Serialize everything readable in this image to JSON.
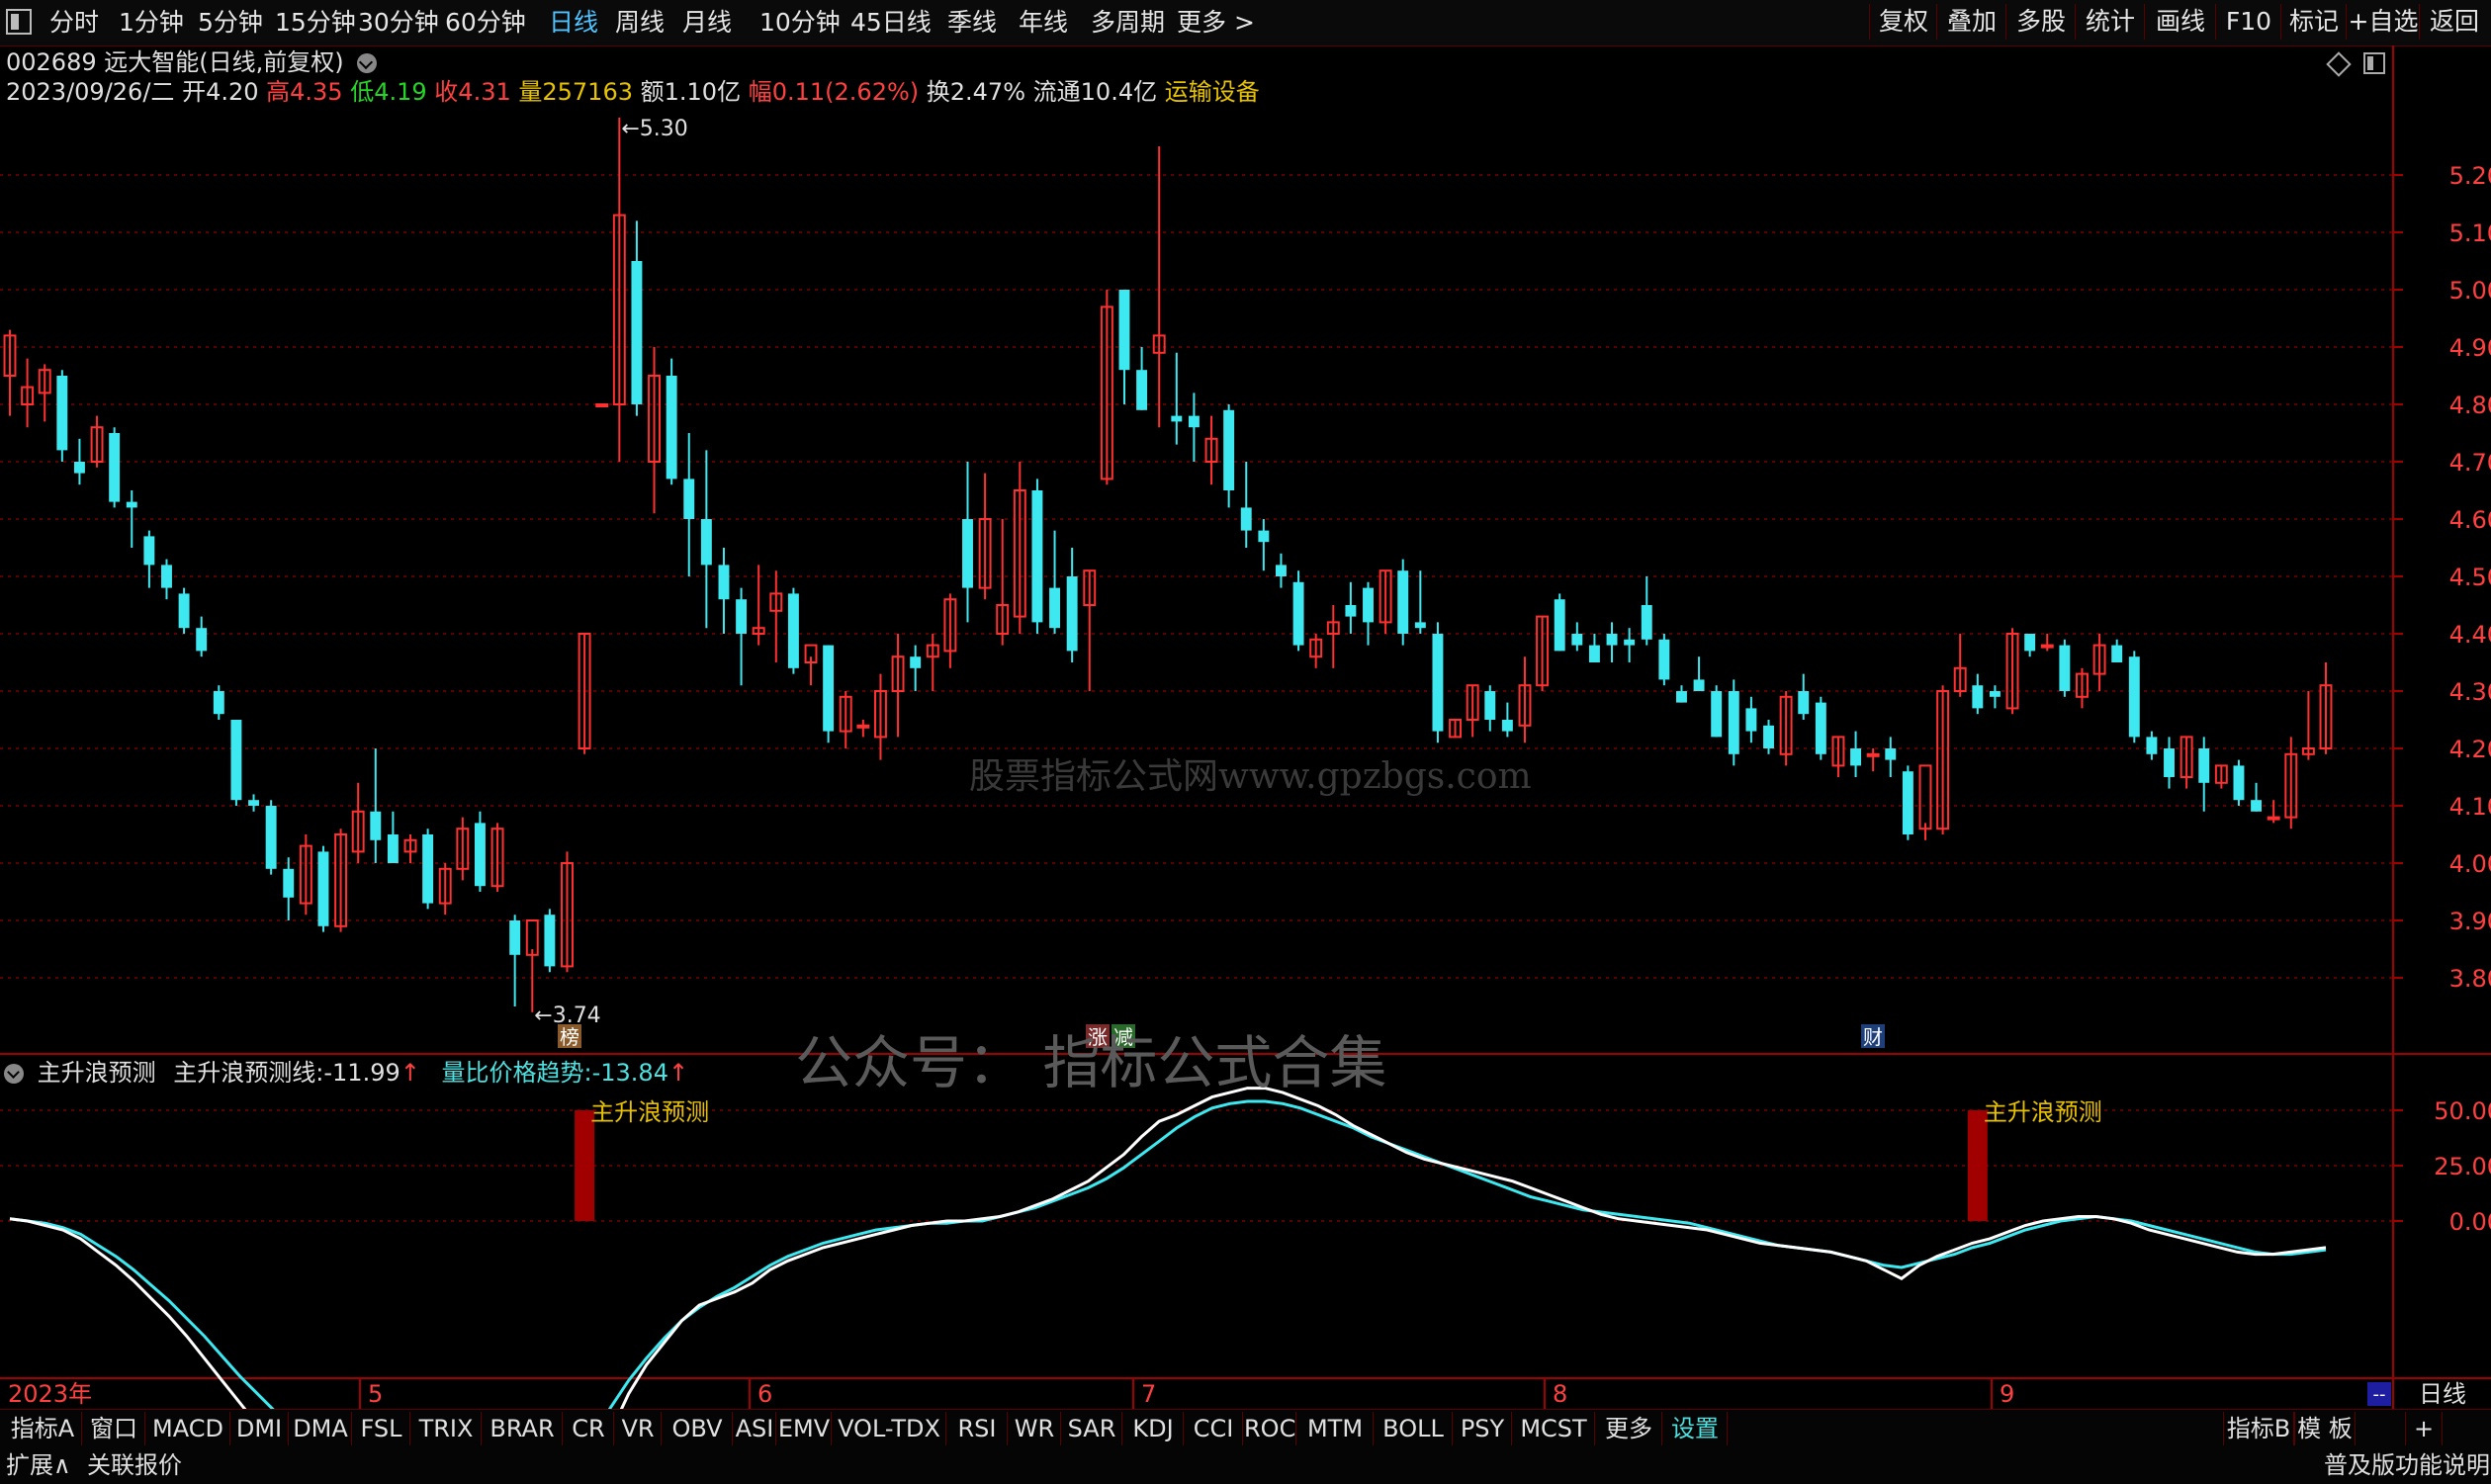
{
  "topbar": {
    "menu_icon": "menu-square-icon",
    "periods": [
      "分时",
      "1分钟",
      "5分钟",
      "15分钟",
      "30分钟",
      "60分钟",
      "日线",
      "周线",
      "月线",
      "10分钟",
      "45日线",
      "季线",
      "年线",
      "多周期",
      "更多 >"
    ],
    "active_period": "日线",
    "right_buttons": [
      "复权",
      "叠加",
      "多股",
      "统计",
      "画线",
      "F10",
      "标记",
      "+自选",
      "返回"
    ]
  },
  "stock": {
    "code_name": "002689 远大智能(日线,前复权)",
    "date": "2023/09/26/二",
    "open_label": "开",
    "open": "4.20",
    "high_label": "高",
    "high": "4.35",
    "low_label": "低",
    "low": "4.19",
    "close_label": "收",
    "close": "4.31",
    "volume_label": "量",
    "volume": "257163",
    "amount_label": "额",
    "amount": "1.10亿",
    "change_label": "幅",
    "change": "0.11(2.62%)",
    "turnover_label": "换",
    "turnover": "2.47%",
    "float_label": "流通",
    "float": "10.4亿",
    "sector": "运输设备"
  },
  "price_axis": [
    "5.20",
    "5.10",
    "5.00",
    "4.90",
    "4.80",
    "4.70",
    "4.60",
    "4.50",
    "4.40",
    "4.30",
    "4.20",
    "4.10",
    "4.00",
    "3.90",
    "3.80"
  ],
  "annotations": {
    "max": "5.30",
    "min": "3.74",
    "tag1": "榜",
    "tag2": "涨",
    "tag3": "减",
    "tag4": "财"
  },
  "watermarks": {
    "center": "股票指标公式网www.gpzbgs.com",
    "bottom": "公众号：  指标公式合集"
  },
  "indicator": {
    "title": "主升浪预测",
    "line1_label": "主升浪预测线:",
    "line1_value": "-11.99",
    "line2_label": "量比价格趋势:",
    "line2_value": "-13.84",
    "signal_label": "主升浪预测",
    "axis": [
      "50.00",
      "25.00",
      "0.00"
    ]
  },
  "time_axis": {
    "year": "2023年",
    "months": [
      "5",
      "6",
      "7",
      "8",
      "9"
    ],
    "period": "日线"
  },
  "bottom_tabs": [
    "指标A",
    "窗口",
    "MACD",
    "DMI",
    "DMA",
    "FSL",
    "TRIX",
    "BRAR",
    "CR",
    "VR",
    "OBV",
    "ASI",
    "EMV",
    "VOL-TDX",
    "RSI",
    "WR",
    "SAR",
    "KDJ",
    "CCI",
    "ROC",
    "MTM",
    "BOLL",
    "PSY",
    "MCST",
    "更多",
    "设置"
  ],
  "bottom_right": [
    "指标B",
    "模 板",
    "+"
  ],
  "status": {
    "left1": "扩展∧",
    "left2": "关联报价",
    "right": "普及版功能说明"
  },
  "colors": {
    "up": "#ff3030",
    "down": "#3ee8f0",
    "grid": "#7a0000",
    "signal": "#a00000"
  },
  "chart_data": {
    "type": "candlestick",
    "ylim": [
      3.74,
      5.3
    ],
    "candles": [
      [
        4.85,
        4.93,
        4.78,
        4.92
      ],
      [
        4.8,
        4.88,
        4.76,
        4.83
      ],
      [
        4.82,
        4.87,
        4.77,
        4.86
      ],
      [
        4.85,
        4.86,
        4.7,
        4.72
      ],
      [
        4.7,
        4.74,
        4.66,
        4.68
      ],
      [
        4.7,
        4.78,
        4.69,
        4.76
      ],
      [
        4.75,
        4.76,
        4.62,
        4.63
      ],
      [
        4.63,
        4.65,
        4.55,
        4.62
      ],
      [
        4.57,
        4.58,
        4.48,
        4.52
      ],
      [
        4.52,
        4.53,
        4.46,
        4.48
      ],
      [
        4.47,
        4.48,
        4.4,
        4.41
      ],
      [
        4.41,
        4.43,
        4.36,
        4.37
      ],
      [
        4.3,
        4.31,
        4.25,
        4.26
      ],
      [
        4.25,
        4.25,
        4.1,
        4.11
      ],
      [
        4.11,
        4.12,
        4.09,
        4.1
      ],
      [
        4.1,
        4.11,
        3.98,
        3.99
      ],
      [
        3.99,
        4.01,
        3.9,
        3.94
      ],
      [
        3.93,
        4.05,
        3.91,
        4.03
      ],
      [
        4.02,
        4.03,
        3.88,
        3.89
      ],
      [
        3.89,
        4.06,
        3.88,
        4.05
      ],
      [
        4.02,
        4.14,
        4.0,
        4.09
      ],
      [
        4.09,
        4.2,
        4.0,
        4.04
      ],
      [
        4.05,
        4.09,
        4.0,
        4.0
      ],
      [
        4.02,
        4.05,
        4.0,
        4.04
      ],
      [
        4.05,
        4.06,
        3.92,
        3.93
      ],
      [
        3.93,
        4.0,
        3.91,
        3.99
      ],
      [
        3.99,
        4.08,
        3.97,
        4.06
      ],
      [
        4.07,
        4.09,
        3.95,
        3.96
      ],
      [
        3.96,
        4.07,
        3.95,
        4.06
      ],
      [
        3.9,
        3.91,
        3.75,
        3.84
      ],
      [
        3.84,
        3.85,
        3.74,
        3.9
      ],
      [
        3.91,
        3.92,
        3.81,
        3.82
      ],
      [
        3.82,
        4.02,
        3.81,
        4.0
      ],
      [
        4.2,
        4.4,
        4.19,
        4.4
      ],
      [
        4.8,
        4.8,
        4.8,
        4.8
      ],
      [
        4.8,
        5.3,
        4.7,
        5.13
      ],
      [
        5.05,
        5.12,
        4.78,
        4.8
      ],
      [
        4.7,
        4.9,
        4.61,
        4.85
      ],
      [
        4.85,
        4.88,
        4.66,
        4.67
      ],
      [
        4.67,
        4.75,
        4.5,
        4.6
      ],
      [
        4.6,
        4.72,
        4.41,
        4.52
      ],
      [
        4.52,
        4.55,
        4.4,
        4.46
      ],
      [
        4.46,
        4.48,
        4.31,
        4.4
      ],
      [
        4.4,
        4.52,
        4.38,
        4.41
      ],
      [
        4.44,
        4.51,
        4.35,
        4.47
      ],
      [
        4.47,
        4.48,
        4.33,
        4.34
      ],
      [
        4.35,
        4.36,
        4.31,
        4.38
      ],
      [
        4.38,
        4.38,
        4.21,
        4.23
      ],
      [
        4.23,
        4.3,
        4.2,
        4.29
      ],
      [
        4.24,
        4.25,
        4.22,
        4.24
      ],
      [
        4.22,
        4.33,
        4.18,
        4.3
      ],
      [
        4.3,
        4.4,
        4.22,
        4.36
      ],
      [
        4.36,
        4.38,
        4.3,
        4.34
      ],
      [
        4.36,
        4.4,
        4.3,
        4.38
      ],
      [
        4.37,
        4.47,
        4.34,
        4.46
      ],
      [
        4.6,
        4.7,
        4.42,
        4.48
      ],
      [
        4.48,
        4.68,
        4.46,
        4.6
      ],
      [
        4.4,
        4.6,
        4.38,
        4.45
      ],
      [
        4.43,
        4.7,
        4.4,
        4.65
      ],
      [
        4.65,
        4.67,
        4.4,
        4.42
      ],
      [
        4.48,
        4.58,
        4.4,
        4.41
      ],
      [
        4.5,
        4.55,
        4.35,
        4.37
      ],
      [
        4.45,
        4.51,
        4.3,
        4.51
      ],
      [
        4.67,
        5.0,
        4.66,
        4.97
      ],
      [
        5.0,
        5.0,
        4.8,
        4.86
      ],
      [
        4.86,
        4.9,
        4.79,
        4.79
      ],
      [
        4.89,
        5.25,
        4.76,
        4.92
      ],
      [
        4.78,
        4.89,
        4.73,
        4.77
      ],
      [
        4.78,
        4.82,
        4.7,
        4.76
      ],
      [
        4.7,
        4.78,
        4.66,
        4.74
      ],
      [
        4.79,
        4.8,
        4.62,
        4.65
      ],
      [
        4.62,
        4.7,
        4.55,
        4.58
      ],
      [
        4.58,
        4.6,
        4.51,
        4.56
      ],
      [
        4.52,
        4.54,
        4.48,
        4.5
      ],
      [
        4.49,
        4.51,
        4.37,
        4.38
      ],
      [
        4.36,
        4.4,
        4.34,
        4.39
      ],
      [
        4.4,
        4.45,
        4.34,
        4.42
      ],
      [
        4.45,
        4.49,
        4.4,
        4.43
      ],
      [
        4.48,
        4.49,
        4.38,
        4.42
      ],
      [
        4.42,
        4.51,
        4.4,
        4.51
      ],
      [
        4.51,
        4.53,
        4.38,
        4.4
      ],
      [
        4.42,
        4.51,
        4.4,
        4.41
      ],
      [
        4.4,
        4.42,
        4.21,
        4.23
      ],
      [
        4.22,
        4.25,
        4.22,
        4.25
      ],
      [
        4.25,
        4.31,
        4.22,
        4.31
      ],
      [
        4.3,
        4.31,
        4.23,
        4.25
      ],
      [
        4.25,
        4.28,
        4.22,
        4.23
      ],
      [
        4.24,
        4.36,
        4.21,
        4.31
      ],
      [
        4.31,
        4.43,
        4.3,
        4.43
      ],
      [
        4.46,
        4.47,
        4.37,
        4.37
      ],
      [
        4.4,
        4.42,
        4.37,
        4.38
      ],
      [
        4.38,
        4.4,
        4.35,
        4.35
      ],
      [
        4.4,
        4.42,
        4.35,
        4.38
      ],
      [
        4.39,
        4.41,
        4.35,
        4.38
      ],
      [
        4.45,
        4.5,
        4.38,
        4.39
      ],
      [
        4.39,
        4.4,
        4.31,
        4.32
      ],
      [
        4.3,
        4.31,
        4.28,
        4.28
      ],
      [
        4.32,
        4.36,
        4.31,
        4.3
      ],
      [
        4.3,
        4.31,
        4.22,
        4.22
      ],
      [
        4.3,
        4.32,
        4.17,
        4.19
      ],
      [
        4.27,
        4.29,
        4.21,
        4.23
      ],
      [
        4.24,
        4.25,
        4.19,
        4.2
      ],
      [
        4.19,
        4.3,
        4.17,
        4.29
      ],
      [
        4.3,
        4.33,
        4.25,
        4.26
      ],
      [
        4.28,
        4.29,
        4.18,
        4.19
      ],
      [
        4.17,
        4.22,
        4.15,
        4.22
      ],
      [
        4.2,
        4.23,
        4.15,
        4.17
      ],
      [
        4.19,
        4.2,
        4.16,
        4.19
      ],
      [
        4.2,
        4.22,
        4.15,
        4.18
      ],
      [
        4.16,
        4.17,
        4.04,
        4.05
      ],
      [
        4.06,
        4.07,
        4.04,
        4.17
      ],
      [
        4.06,
        4.31,
        4.05,
        4.3
      ],
      [
        4.3,
        4.4,
        4.29,
        4.34
      ],
      [
        4.31,
        4.33,
        4.26,
        4.27
      ],
      [
        4.3,
        4.31,
        4.27,
        4.29
      ],
      [
        4.27,
        4.41,
        4.26,
        4.4
      ],
      [
        4.4,
        4.4,
        4.36,
        4.37
      ],
      [
        4.38,
        4.4,
        4.37,
        4.38
      ],
      [
        4.38,
        4.39,
        4.29,
        4.3
      ],
      [
        4.29,
        4.34,
        4.27,
        4.33
      ],
      [
        4.33,
        4.4,
        4.3,
        4.38
      ],
      [
        4.38,
        4.39,
        4.35,
        4.35
      ],
      [
        4.36,
        4.37,
        4.21,
        4.22
      ],
      [
        4.22,
        4.23,
        4.18,
        4.19
      ],
      [
        4.2,
        4.22,
        4.13,
        4.15
      ],
      [
        4.15,
        4.22,
        4.13,
        4.22
      ],
      [
        4.2,
        4.22,
        4.09,
        4.14
      ],
      [
        4.14,
        4.17,
        4.13,
        4.17
      ],
      [
        4.17,
        4.18,
        4.1,
        4.11
      ],
      [
        4.11,
        4.14,
        4.09,
        4.09
      ],
      [
        4.08,
        4.11,
        4.07,
        4.08
      ],
      [
        4.08,
        4.22,
        4.06,
        4.19
      ],
      [
        4.19,
        4.3,
        4.18,
        4.2
      ],
      [
        4.2,
        4.35,
        4.19,
        4.31
      ]
    ],
    "signal_bars_index": [
      33,
      113
    ],
    "line1": [
      1,
      0,
      -2,
      -4,
      -8,
      -14,
      -20,
      -27,
      -35,
      -43,
      -52,
      -62,
      -72,
      -82,
      -92,
      -100,
      -106,
      -108,
      -109,
      -110,
      -111,
      -112,
      -114,
      -116,
      -117,
      -118,
      -120,
      -122,
      -124,
      -125,
      -127,
      -128,
      -125,
      -110,
      -95,
      -78,
      -65,
      -55,
      -45,
      -38,
      -35,
      -32,
      -28,
      -22,
      -18,
      -15,
      -12,
      -10,
      -8,
      -6,
      -4,
      -2,
      -1,
      0,
      0,
      1,
      2,
      4,
      7,
      10,
      14,
      18,
      24,
      30,
      38,
      45,
      48,
      52,
      56,
      58,
      60,
      60,
      58,
      55,
      52,
      48,
      43,
      39,
      35,
      31,
      28,
      26,
      24,
      22,
      20,
      18,
      15,
      12,
      9,
      6,
      3,
      1,
      0,
      -1,
      -2,
      -3,
      -4,
      -6,
      -8,
      -10,
      -11,
      -12,
      -13,
      -14,
      -16,
      -18,
      -22,
      -26,
      -20,
      -16,
      -13,
      -10,
      -8,
      -5,
      -2,
      0,
      1,
      2,
      2,
      1,
      -1,
      -4,
      -6,
      -8,
      -10,
      -12,
      -14,
      -15,
      -15,
      -14,
      -13,
      -12
    ],
    "line2": [
      1,
      0,
      -1,
      -3,
      -6,
      -11,
      -16,
      -22,
      -29,
      -36,
      -44,
      -52,
      -61,
      -70,
      -78,
      -86,
      -93,
      -98,
      -102,
      -105,
      -108,
      -111,
      -114,
      -117,
      -119,
      -121,
      -123,
      -125,
      -126,
      -127,
      -126,
      -122,
      -110,
      -96,
      -84,
      -72,
      -62,
      -53,
      -45,
      -39,
      -34,
      -30,
      -25,
      -20,
      -16,
      -13,
      -10,
      -8,
      -6,
      -4,
      -3,
      -2,
      -1,
      -1,
      0,
      0,
      2,
      4,
      6,
      9,
      12,
      15,
      19,
      24,
      30,
      36,
      42,
      47,
      51,
      53,
      54,
      54,
      53,
      51,
      48,
      45,
      42,
      38,
      35,
      32,
      29,
      26,
      23,
      20,
      17,
      14,
      11,
      9,
      7,
      5,
      4,
      3,
      2,
      1,
      0,
      -1,
      -3,
      -5,
      -7,
      -9,
      -11,
      -12,
      -13,
      -14,
      -16,
      -18,
      -20,
      -21,
      -19,
      -17,
      -15,
      -12,
      -10,
      -7,
      -4,
      -2,
      0,
      1,
      2,
      1,
      0,
      -2,
      -4,
      -6,
      -8,
      -10,
      -12,
      -14,
      -15,
      -15,
      -14,
      -13
    ]
  }
}
